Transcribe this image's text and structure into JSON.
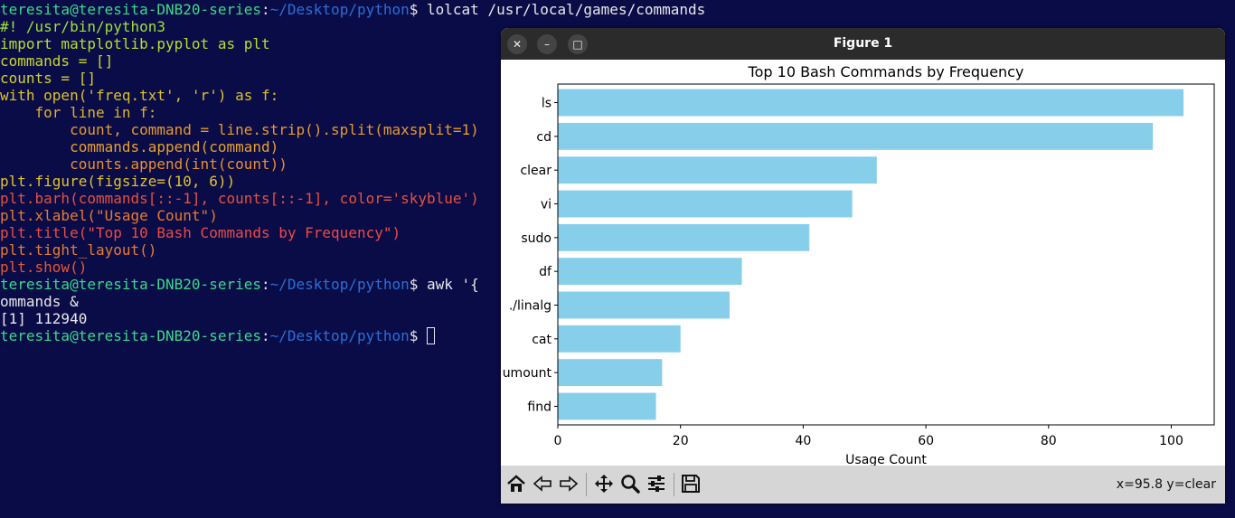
{
  "terminal": {
    "lines": [
      [
        {
          "t": "teresita@teresita-DNB20-series",
          "c": "#3ad98a"
        },
        {
          "t": ":",
          "c": "#e8e8e8"
        },
        {
          "t": "~/Desktop/python",
          "c": "#2a6fd6"
        },
        {
          "t": "$ lolcat /usr/local/games/commands",
          "c": "#e8e8e8"
        }
      ],
      [
        {
          "t": "#! /usr/bin/python3",
          "c": "#9fe03a"
        }
      ],
      [
        {
          "t": "import matplotlib.pyplot as plt",
          "c": "#b6df2b"
        }
      ],
      [
        {
          "t": "commands = []",
          "c": "#c8d829"
        }
      ],
      [
        {
          "t": "counts = []",
          "c": "#d2cf2a"
        }
      ],
      [
        {
          "t": "with open('freq.txt', 'r') as f:",
          "c": "#dcc22a"
        }
      ],
      [
        {
          "t": "    for line in f:",
          "c": "#e2b22b"
        }
      ],
      [
        {
          "t": "        count, command = line.strip().split(maxsplit=1)",
          "c": "#e69a2c"
        }
      ],
      [
        {
          "t": "        commands.append(command)",
          "c": "#e8a02c"
        }
      ],
      [
        {
          "t": "        counts.append(int(count))",
          "c": "#ea8e2e"
        }
      ],
      [
        {
          "t": "plt.figure(figsize=(10, 6))",
          "c": "#e2c22a"
        }
      ],
      [
        {
          "t": "plt.barh(commands[::-1], counts[::-1], color='skyblue')",
          "c": "#e8503a"
        }
      ],
      [
        {
          "t": "plt.xlabel(\"Usage Count\")",
          "c": "#ea7a30"
        }
      ],
      [
        {
          "t": "plt.title(\"Top 10 Bash Commands by Frequency\")",
          "c": "#ec4a44"
        }
      ],
      [
        {
          "t": "plt.tight_layout()",
          "c": "#ea7a30"
        }
      ],
      [
        {
          "t": "plt.show()",
          "c": "#e8582e"
        }
      ],
      [
        {
          "t": "teresita@teresita-DNB20-series",
          "c": "#3ad98a"
        },
        {
          "t": ":",
          "c": "#e8e8e8"
        },
        {
          "t": "~/Desktop/python",
          "c": "#2a6fd6"
        },
        {
          "t": "$ awk '{",
          "c": "#e8e8e8"
        }
      ],
      [
        {
          "t": "ommands &",
          "c": "#e8e8e8"
        }
      ],
      [
        {
          "t": "[1] 112940",
          "c": "#e8e8e8"
        }
      ],
      [
        {
          "t": "teresita@teresita-DNB20-series",
          "c": "#3ad98a"
        },
        {
          "t": ":",
          "c": "#e8e8e8"
        },
        {
          "t": "~/Desktop/python",
          "c": "#2a6fd6"
        },
        {
          "t": "$ ",
          "c": "#e8e8e8"
        }
      ]
    ]
  },
  "window": {
    "title": "Figure 1",
    "close_icon": "close-icon",
    "minimize_icon": "minimize-icon",
    "maximize_icon": "maximize-icon"
  },
  "toolbar": {
    "buttons": [
      "home-icon",
      "back-icon",
      "forward-icon",
      "pan-icon",
      "zoom-icon",
      "configure-subplots-icon",
      "save-icon"
    ],
    "coord_readout": "x=95.8 y=clear"
  },
  "chart_data": {
    "type": "bar",
    "orientation": "horizontal",
    "title": "Top 10 Bash Commands by Frequency",
    "xlabel": "Usage Count",
    "ylabel": "",
    "categories": [
      "ls",
      "cd",
      "clear",
      "vi",
      "sudo",
      "df",
      "./linalg",
      "cat",
      "umount",
      "find"
    ],
    "values": [
      102,
      97,
      52,
      48,
      41,
      30,
      28,
      20,
      17,
      16
    ],
    "xlim": [
      0,
      107
    ],
    "xticks": [
      0,
      20,
      40,
      60,
      80,
      100
    ],
    "color": "#87ceeb",
    "grid": false
  }
}
